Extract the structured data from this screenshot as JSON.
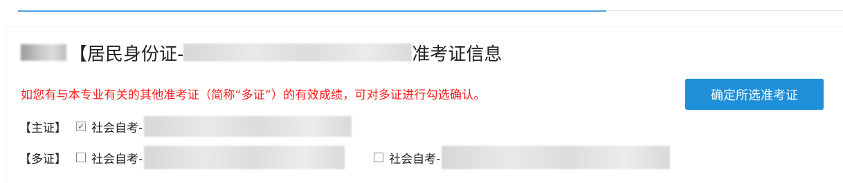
{
  "header": {
    "title_prefix": "【居民身份证-",
    "title_suffix": "准考证信息"
  },
  "notice": {
    "text": "如您有与本专业有关的其他准考证（简称“多证”）的有效成绩，可对多证进行勾选确认。",
    "color": "#ff1a1a"
  },
  "actions": {
    "confirm_label": "确定所选准考证",
    "accent": "#1e8fd8"
  },
  "main_cert": {
    "tag": "【主证】",
    "checked": true,
    "label": "社会自考-"
  },
  "multi_certs": {
    "tag": "【多证】",
    "items": [
      {
        "checked": false,
        "label": "社会自考-"
      },
      {
        "checked": false,
        "label": "社会自考-"
      }
    ]
  },
  "icons": {
    "checked_mark": "✓"
  }
}
